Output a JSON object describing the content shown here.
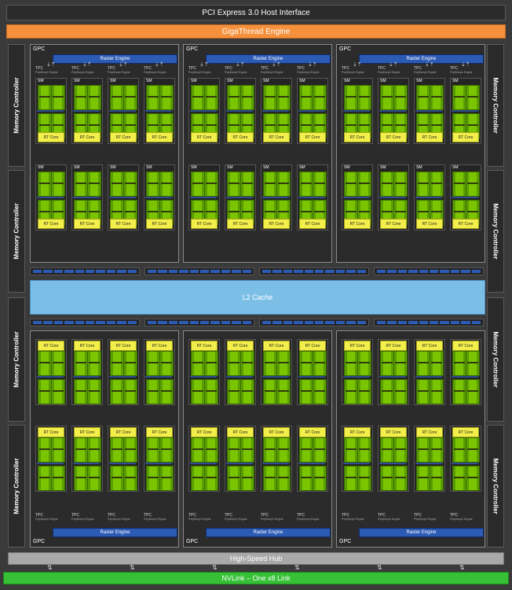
{
  "title": "PCI Express 3.0 Host Interface",
  "giga_thread": "GigaThread Engine",
  "memory_controller": "Memory Controller",
  "l2_cache": "L2 Cache",
  "hub": "High-Speed Hub",
  "nvlink": "NVLink – One x8 Link",
  "gpc_label": "GPC",
  "raster_engine": "Raster Engine",
  "tpc_label": "TPC",
  "polymorph": "PolyMorph Engine",
  "sm_label": "SM",
  "rt_core": "RT Core",
  "colors": {
    "giga": "#f5913c",
    "raster": "#2c5bb5",
    "cuda": "#7bc400",
    "rt": "#f2ee4a",
    "l2": "#7bbfe6",
    "hub": "#a9a9a9",
    "nvlink": "#35c035"
  }
}
